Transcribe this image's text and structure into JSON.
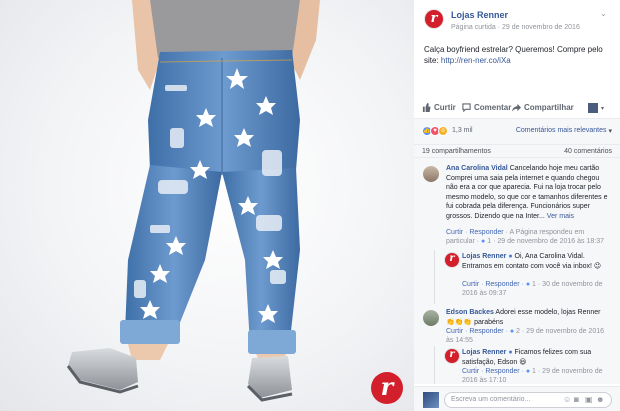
{
  "post": {
    "page_name": "Lojas Renner",
    "page_type": "Página curtida",
    "date": "29 de novembro de 2016",
    "text": "Calça boyfriend estrelar? Queremos! Compre pelo site:",
    "link": "http://ren-ner.co/iXa"
  },
  "actions": {
    "like": "Curtir",
    "comment": "Comentar",
    "share": "Compartilhar"
  },
  "reactions": {
    "count": "1,3 mil",
    "sort_label": "Comentários mais relevantes"
  },
  "stats": {
    "shares": "19 compartilhamentos",
    "comments": "40 comentários"
  },
  "comments": [
    {
      "name": "Ana Carolina Vidal",
      "text": "Cancelando hoje meu cartão Comprei uma saia pela internet e quando chegou não era a cor que aparecia. Fui na loja trocar pelo mesmo modelo, so que cor e tamanhos diferentes e fui cobrada pela diferença. Funcionários super grossos. Dizendo que na Inter...",
      "see_more": "Ver mais",
      "like": "Curtir",
      "reply": "Responder",
      "page_replied": "A Página respondeu em particular",
      "likes": "1",
      "date": "29 de novembro de 2016 às 18:37"
    },
    {
      "name": "Lojas Renner",
      "text": "Oi, Ana Carolina Vidal. Entramos em contato com você via inbox! 😉",
      "like": "Curtir",
      "reply": "Responder",
      "likes": "1",
      "date": "30 de novembro de 2016 às 09:37"
    },
    {
      "name": "Edson Backes",
      "text": "Adorei esse modelo, lojas Renner 👏👏👏 parabéns",
      "like": "Curtir",
      "reply": "Responder",
      "likes": "2",
      "date": "29 de novembro de 2016 às 14:55"
    },
    {
      "name": "Lojas Renner",
      "text": "Ficamos felizes com sua satisfação, Edson 😃",
      "like": "Curtir",
      "reply": "Responder",
      "likes": "1",
      "date": "29 de novembro de 2016 às 17:10"
    }
  ],
  "composer": {
    "placeholder": "Escreva um comentário..."
  },
  "photo": {
    "logo_letter": "r"
  },
  "colors": {
    "fb_blue": "#365899",
    "brand_red": "#d21f2b",
    "denim": "#4f7fb7"
  }
}
